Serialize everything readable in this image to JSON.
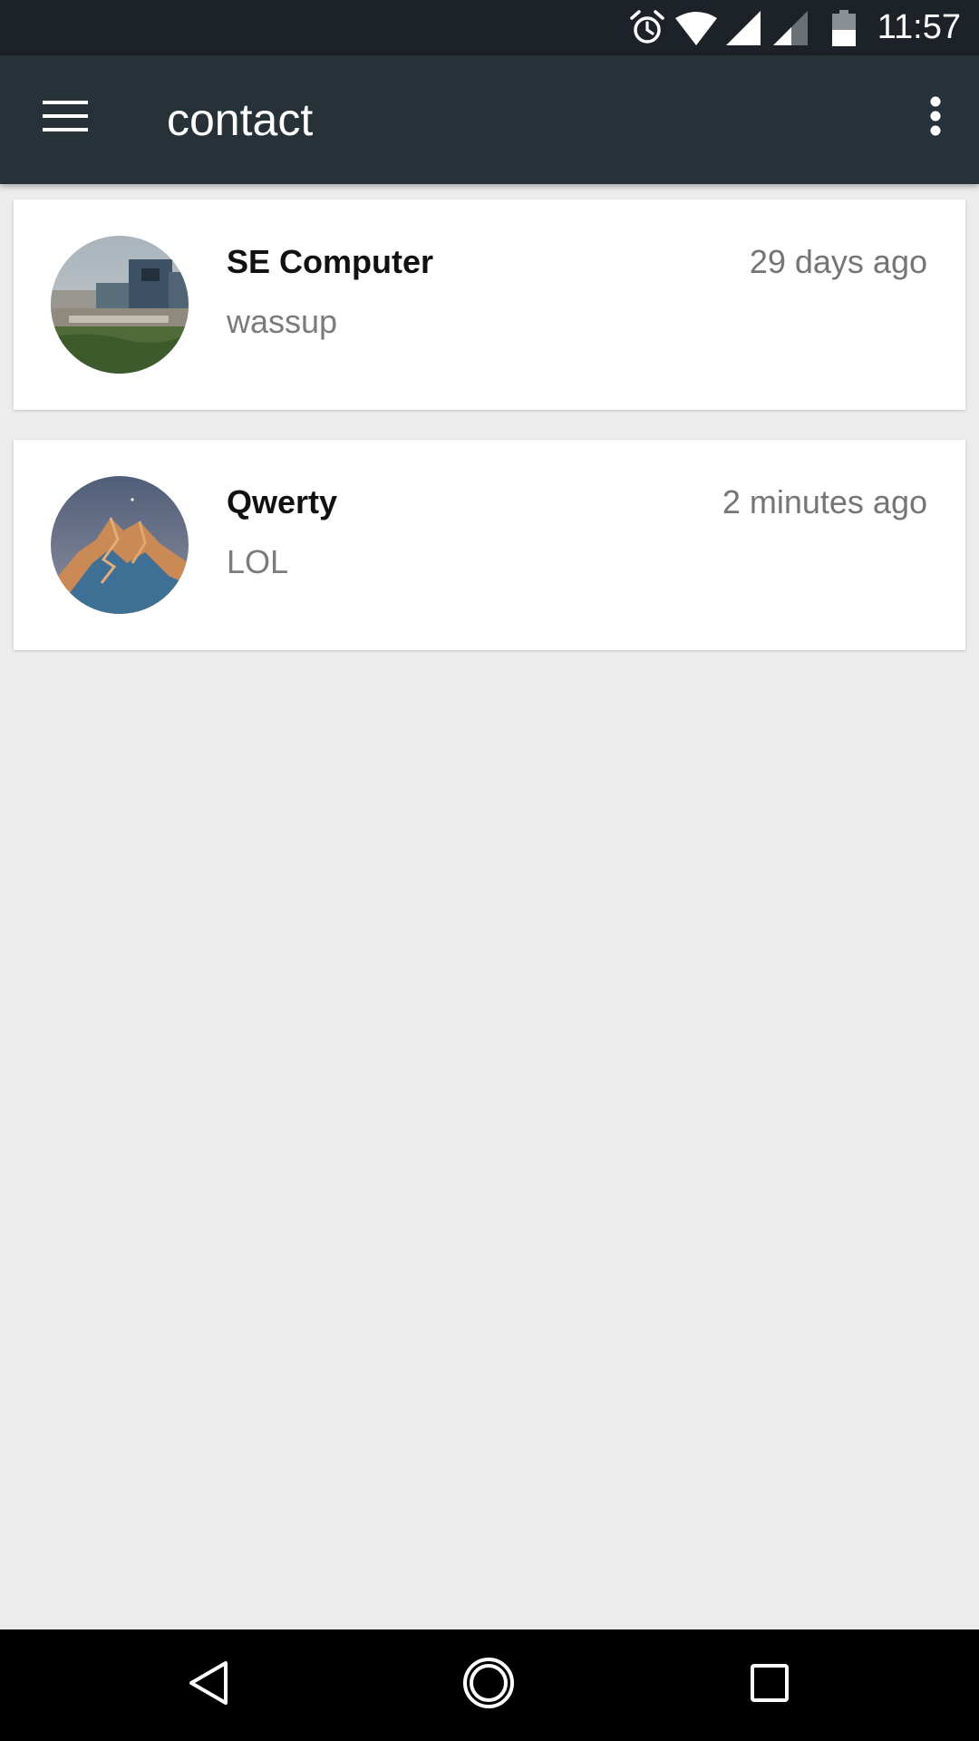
{
  "status_bar": {
    "time": "11:57",
    "icons": [
      "alarm-icon",
      "wifi-icon",
      "signal-icon",
      "signal-weak-icon",
      "battery-icon"
    ]
  },
  "app_bar": {
    "title": "contact",
    "menu_icon": "hamburger-menu-icon",
    "more_icon": "more-vert-icon"
  },
  "contacts": [
    {
      "name": "SE Computer",
      "message": "wassup",
      "time": "29 days ago",
      "avatar": "building-photo-avatar"
    },
    {
      "name": "Qwerty",
      "message": "LOL",
      "time": "2 minutes ago",
      "avatar": "mountain-photo-avatar"
    }
  ],
  "nav_bar": {
    "back_icon": "back-triangle-icon",
    "home_icon": "home-circle-icon",
    "recents_icon": "recents-square-icon"
  },
  "colors": {
    "status_bar": "#1c2228",
    "app_bar": "#263238",
    "background": "#ececec",
    "card": "#ffffff",
    "name_text": "#111111",
    "secondary_text": "#757575",
    "nav_bar": "#000000"
  }
}
